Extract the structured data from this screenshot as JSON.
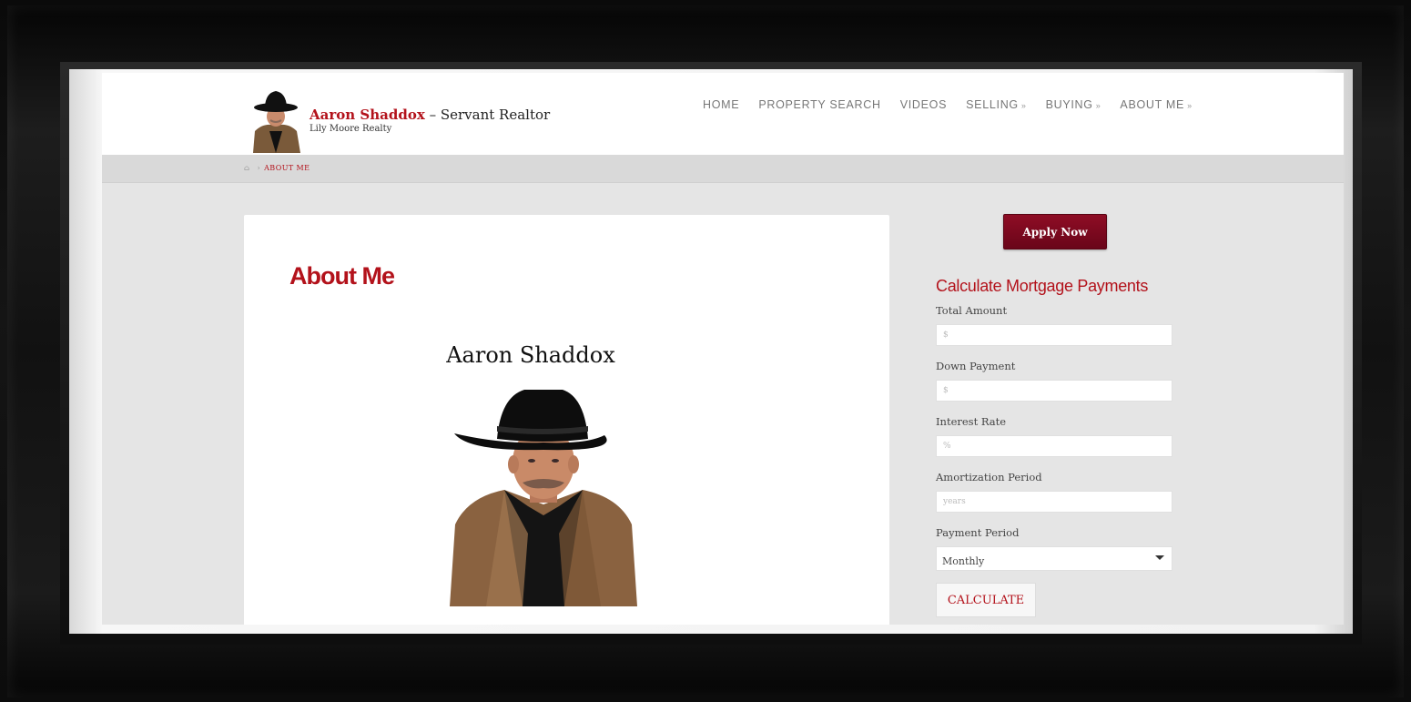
{
  "brand": {
    "name": "Aaron Shaddox",
    "tagline": "– Servant Realtor",
    "company": "Lily Moore Realty"
  },
  "nav": [
    {
      "label": "HOME",
      "dropdown": false
    },
    {
      "label": "PROPERTY SEARCH",
      "dropdown": false
    },
    {
      "label": "VIDEOS",
      "dropdown": false
    },
    {
      "label": "SELLING",
      "dropdown": true
    },
    {
      "label": "BUYING",
      "dropdown": true
    },
    {
      "label": "ABOUT ME",
      "dropdown": true
    }
  ],
  "breadcrumb": {
    "current": "ABOUT ME"
  },
  "main": {
    "title": "About Me",
    "person_name": "Aaron Shaddox"
  },
  "sidebar": {
    "apply_label": "Apply Now",
    "calculator": {
      "title": "Calculate Mortgage Payments",
      "fields": [
        {
          "label": "Total Amount",
          "placeholder": "$"
        },
        {
          "label": "Down Payment",
          "placeholder": "$"
        },
        {
          "label": "Interest Rate",
          "placeholder": "%"
        },
        {
          "label": "Amortization Period",
          "placeholder": "years"
        }
      ],
      "payment_period_label": "Payment Period",
      "payment_period_value": "Monthly",
      "calculate_label": "CALCULATE"
    }
  },
  "colors": {
    "accent_red": "#b3121b",
    "apply_button": "#7a0a1f"
  },
  "icons": {
    "home": "home-icon",
    "dropdown": "chevron-down-icon"
  }
}
